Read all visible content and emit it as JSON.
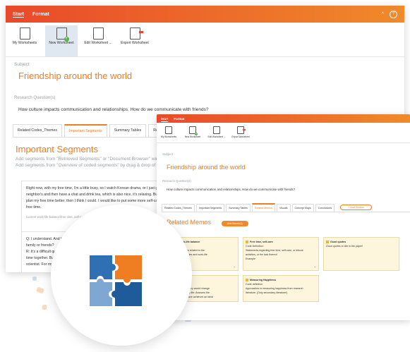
{
  "window1": {
    "menu": {
      "tab_start": "Start",
      "tab_format": "Format",
      "caret": "^",
      "help": "?"
    },
    "ribbon": [
      {
        "label": "My Worksheets"
      },
      {
        "label": "New Worksheet"
      },
      {
        "label": "Edit Worksheet ..."
      },
      {
        "label": "Export Worksheet"
      }
    ],
    "subject_label": "Subject",
    "title": "Friendship around the world",
    "research_label": "Research Question(s)",
    "research_text": "How culture impacts communication and relationships. How do we communicate with friends?",
    "tabs": [
      "Related Codes_Themes",
      "Important Segments",
      "Summary Tables",
      "Related Memo"
    ],
    "section_title": "Important Segments",
    "section_sub1": "Add segments from \"Retrieved Segments\" or \"Document Browser\" wind",
    "section_sub2": "Add segments from \"Overview of coded segments\" by drag & drop of se",
    "segment1": {
      "line1": "Right now, with my free time, I'm a little busy, so I watch Korean drama, or I just go to my",
      "line2": "neighbor's and then have a chat and drink tea, which is also nice, it's relaxing. But if I coul",
      "line3": "plan my free time better, then I think I could. I would like to put some more self-care into m",
      "line4": "free time.",
      "meta": "Current work-life balance\\free time, self-care (interviews\\Thach, Pos. 13-15) Weight score: 50)"
    },
    "segment2": {
      "q": "Q: I understand. And how satisfie",
      "q2": "family or friends?",
      "r": "R: It's a difficult question",
      "r2": "time together. But this",
      "r3": "scientist. For my frien"
    }
  },
  "window2": {
    "menu": {
      "tab_start": "Start",
      "tab_format": "Format"
    },
    "ribbon": [
      {
        "label": "My Worksheets"
      },
      {
        "label": "New Worksheet"
      },
      {
        "label": "Edit Worksheet ..."
      },
      {
        "label": "Export Worksheet"
      }
    ],
    "subject_label": "Subject",
    "title": "Friendship around the world",
    "research_label": "Research Question(s)",
    "research_text": "How culture impacts communication and relationships. How do we communicate with friends?",
    "tabs": [
      "Related Codes_Themes",
      "Important Segments",
      "Summary Tables",
      "Related Memos",
      "Visuals",
      "Concept Maps",
      "Conclusions"
    ],
    "add_section": "+ Add Section",
    "section_title": "Related Memos",
    "add_memo": "Add Memo(s)",
    "memos": [
      {
        "title": "Current work-life balance",
        "l1": "Definition",
        "l2": "...contains sub-codes related to the",
        "l3": "...n of current schedules and work-life"
      },
      {
        "title": "Free time, self-care",
        "l1": "Code Definition:",
        "l2": "Statements regarding free time, self-care, or leisure",
        "l3": "activities, or the lack thereof.",
        "l4": "Example"
      },
      {
        "title": "Good quotes",
        "l1": "Good quotes to cite in the paper!"
      },
      {
        "title": "...k-life balance",
        "l1": "...on",
        "l2": "...' wishes as to how they would change",
        "l3": "...d schedule and daily life. Answers the",
        "l4": "...'imagine that you have achieved an ideal"
      },
      {
        "title": "Measuring Happiness",
        "l1": "Code definition",
        "l2": "Approaches to measuring happiness from research",
        "l3": "literature. (Only secondary literature!)"
      }
    ]
  },
  "colors": {
    "accent": "#ef7d22",
    "header_start": "#e9492a",
    "header_end": "#f08a2a"
  },
  "badge_icon": "puzzle-icon"
}
